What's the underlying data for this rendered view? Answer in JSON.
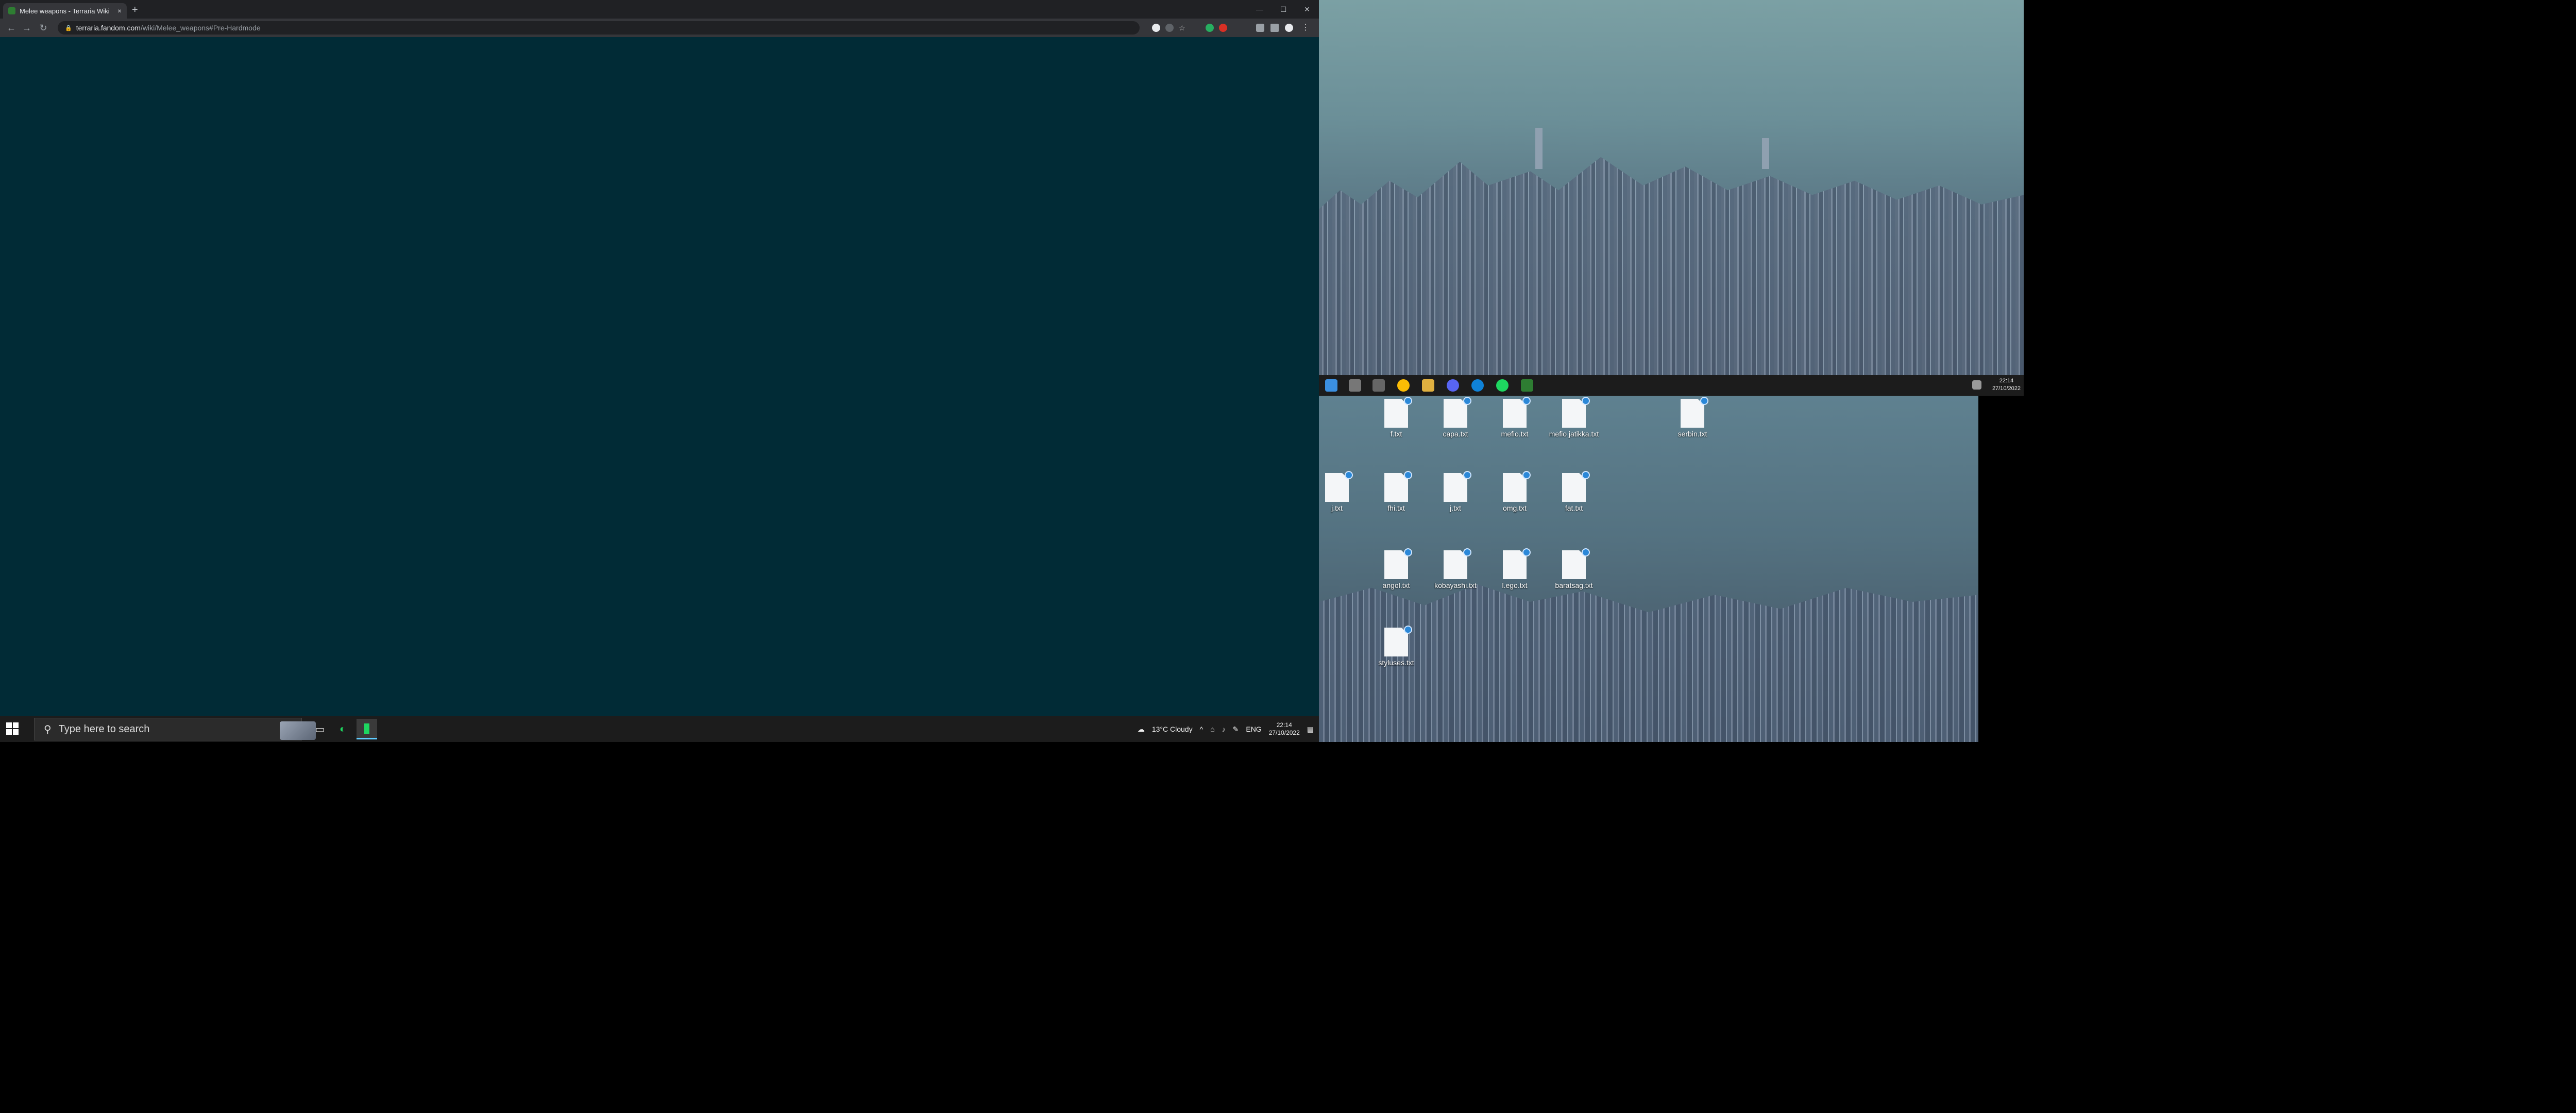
{
  "browser": {
    "tab_title": "Melee weapons - Terraria Wiki",
    "tab_close": "×",
    "new_tab": "+",
    "url_host": "terraria.fandom.com",
    "url_path": "/wiki/Melee_weapons#Pre-Hardmode",
    "win_minimize": "—",
    "win_maximize": "☐",
    "win_close": "✕"
  },
  "taskbar_left": {
    "search_placeholder": "Type here to search",
    "weather": "13°C  Cloudy",
    "language": "ENG",
    "time": "22:14",
    "date": "27/10/2022"
  },
  "taskbar_right_top": {
    "time": "22:14",
    "date": "27/10/2022"
  },
  "desktop_icons": [
    {
      "label": "f.txt"
    },
    {
      "label": "capa.txt"
    },
    {
      "label": "mefio.txt"
    },
    {
      "label": "mefio jatikka.txt"
    },
    {
      "label": "serbin.txt"
    },
    {
      "label": "j.txt"
    },
    {
      "label": "fhi.txt"
    },
    {
      "label": "j.txt"
    },
    {
      "label": "omg.txt"
    },
    {
      "label": "fat.txt"
    },
    {
      "label": "angol.txt"
    },
    {
      "label": "kobayashi.txt"
    },
    {
      "label": "l.ego.txt"
    },
    {
      "label": "baratsag.txt"
    },
    {
      "label": "styluses.txt"
    }
  ]
}
